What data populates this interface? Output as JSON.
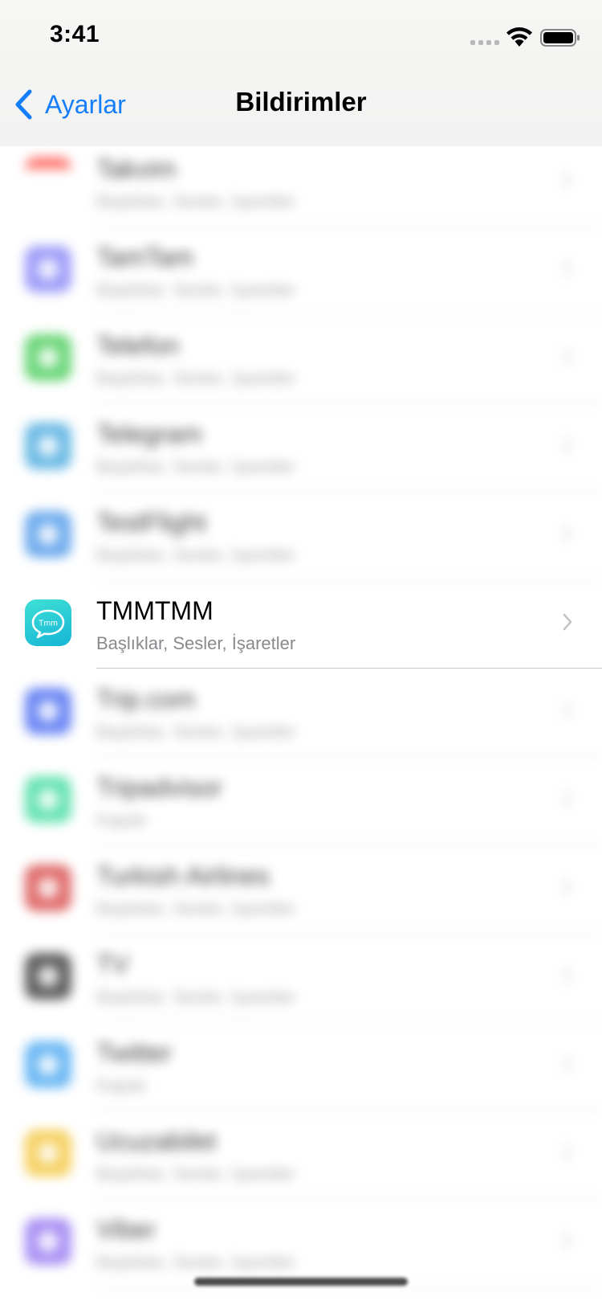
{
  "status_bar": {
    "time": "3:41"
  },
  "nav": {
    "back_label": "Ayarlar",
    "title": "Bildirimler"
  },
  "colors": {
    "accent": "#147efb",
    "header_bg": "#f3f3f2",
    "separator": "#c8c7cc",
    "subtitle": "#8a8a8e"
  },
  "apps": [
    {
      "name": "Takvim",
      "subtitle": "Başlıklar, Sesler, İşaretler",
      "icon": "calendar-icon",
      "color": "#ffffff",
      "blurred": true
    },
    {
      "name": "TamTam",
      "subtitle": "Başlıklar, Sesler, İşaretler",
      "icon": "tamtam-icon",
      "color": "#7f7cf6",
      "blurred": true
    },
    {
      "name": "Telefon",
      "subtitle": "Başlıklar, Sesler, İşaretler",
      "icon": "phone-icon",
      "color": "#38c84a",
      "blurred": true
    },
    {
      "name": "Telegram",
      "subtitle": "Başlıklar, Sesler, İşaretler",
      "icon": "telegram-icon",
      "color": "#3aa3dc",
      "blurred": true
    },
    {
      "name": "TestFlight",
      "subtitle": "Başlıklar, Sesler, İşaretler",
      "icon": "testflight-icon",
      "color": "#3d8fe8",
      "blurred": true
    },
    {
      "name": "TMMTMM",
      "subtitle": "Başlıklar, Sesler, İşaretler",
      "icon": "tmm-chat-icon",
      "color": "#1fc6d8",
      "blurred": false
    },
    {
      "name": "Trip.com",
      "subtitle": "Başlıklar, Sesler, İşaretler",
      "icon": "trip-icon",
      "color": "#3a5ef0",
      "blurred": true
    },
    {
      "name": "Tripadvisor",
      "subtitle": "Kapalı",
      "icon": "tripadvisor-icon",
      "color": "#34d99a",
      "blurred": true
    },
    {
      "name": "Turkish Airlines",
      "subtitle": "Başlıklar, Sesler, İşaretler",
      "icon": "turkish-airlines-icon",
      "color": "#d63a3a",
      "blurred": true
    },
    {
      "name": "TV",
      "subtitle": "Başlıklar, Sesler, İşaretler",
      "icon": "tv-icon",
      "color": "#2a2a2a",
      "blurred": true
    },
    {
      "name": "Twitter",
      "subtitle": "Kapalı",
      "icon": "twitter-icon",
      "color": "#3aa0f0",
      "blurred": true
    },
    {
      "name": "Ucuzabilet",
      "subtitle": "Başlıklar, Sesler, İşaretler",
      "icon": "ucuzabilet-icon",
      "color": "#f2c12e",
      "blurred": true
    },
    {
      "name": "Viber",
      "subtitle": "Başlıklar, Sesler, İşaretler",
      "icon": "viber-icon",
      "color": "#8c6cf0",
      "blurred": true
    }
  ]
}
